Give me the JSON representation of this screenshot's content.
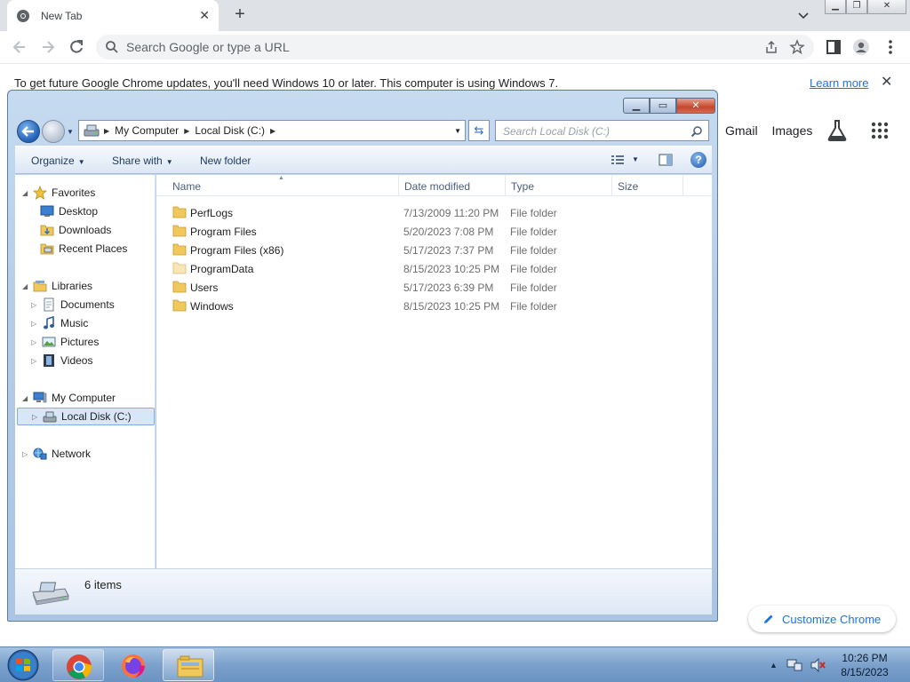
{
  "chrome": {
    "tab_title": "New Tab",
    "omnibox_placeholder": "Search Google or type a URL",
    "infobar_message": "To get future Google Chrome updates, you'll need Windows 10 or later. This computer is using Windows 7.",
    "infobar_link": "Learn more",
    "ntp_links": [
      "Gmail",
      "Images"
    ],
    "customize_label": "Customize Chrome",
    "accent": "#1a73e8"
  },
  "explorer": {
    "breadcrumbs": [
      "My Computer",
      "Local Disk (C:)"
    ],
    "search_placeholder": "Search Local Disk (C:)",
    "commands": {
      "organize": "Organize",
      "share_with": "Share with",
      "new_folder": "New folder"
    },
    "nav": {
      "favorites": "Favorites",
      "desktop": "Desktop",
      "downloads": "Downloads",
      "recent_places": "Recent Places",
      "libraries": "Libraries",
      "documents": "Documents",
      "music": "Music",
      "pictures": "Pictures",
      "videos": "Videos",
      "my_computer": "My Computer",
      "local_disk": "Local Disk (C:)",
      "network": "Network"
    },
    "columns": {
      "name": "Name",
      "date_modified": "Date modified",
      "type": "Type",
      "size": "Size"
    },
    "files": [
      {
        "name": "PerfLogs",
        "date": "7/13/2009 11:20 PM",
        "type": "File folder"
      },
      {
        "name": "Program Files",
        "date": "5/20/2023 7:08 PM",
        "type": "File folder"
      },
      {
        "name": "Program Files (x86)",
        "date": "5/17/2023 7:37 PM",
        "type": "File folder"
      },
      {
        "name": "ProgramData",
        "date": "8/15/2023 10:25 PM",
        "type": "File folder"
      },
      {
        "name": "Users",
        "date": "5/17/2023 6:39 PM",
        "type": "File folder"
      },
      {
        "name": "Windows",
        "date": "8/15/2023 10:25 PM",
        "type": "File folder"
      }
    ],
    "status_count": "6 items"
  },
  "taskbar": {
    "time": "10:26 PM",
    "date": "8/15/2023"
  }
}
